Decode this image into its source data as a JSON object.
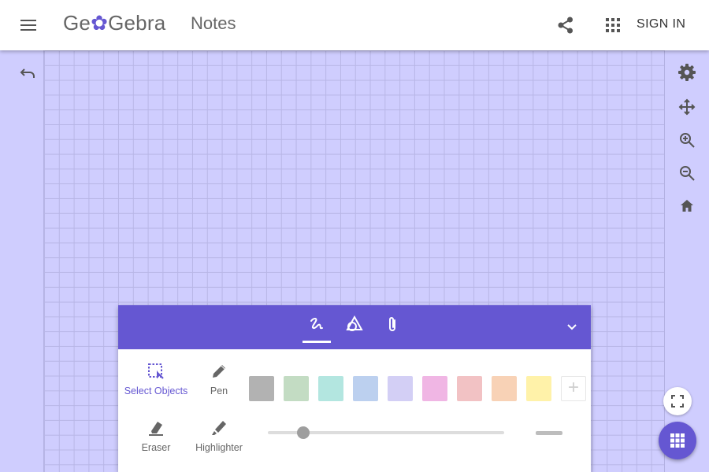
{
  "header": {
    "logo": {
      "prefix": "Ge",
      "flower": "✿",
      "suffix": "Gebra"
    },
    "title": "Notes",
    "signin_label": "SIGN IN"
  },
  "icons": {
    "menu": "menu-icon",
    "share": "share-icon",
    "apps": "apps-grid-icon",
    "undo": "undo-icon",
    "settings": "gear-icon",
    "move": "move-arrows-icon",
    "zoom_in": "zoom-in-icon",
    "zoom_out": "zoom-out-icon",
    "home": "home-icon",
    "fullscreen": "fullscreen-icon",
    "tools_fab": "grid-icon"
  },
  "panel": {
    "tabs": [
      {
        "name": "pen-tools-tab",
        "icon": "scribble-icon",
        "active": true
      },
      {
        "name": "shapes-tab",
        "icon": "shapes-icon",
        "active": false
      },
      {
        "name": "media-tab",
        "icon": "paperclip-icon",
        "active": false
      }
    ],
    "tools": {
      "select": "Select Objects",
      "pen": "Pen",
      "eraser": "Eraser",
      "highlighter": "Highlighter"
    },
    "selected_tool": "select",
    "swatches": [
      "#b2b2b2",
      "#c3dcc3",
      "#b3e6e0",
      "#bcd0ef",
      "#d3cff5",
      "#f0b6e4",
      "#f2c2c4",
      "#f8d2b6",
      "#fff2a9"
    ],
    "add_color": "+",
    "stroke_width": 0.15
  },
  "colors": {
    "accent": "#6557d2",
    "canvas": "#cfcdfe",
    "grid": "#b8b6e6"
  }
}
